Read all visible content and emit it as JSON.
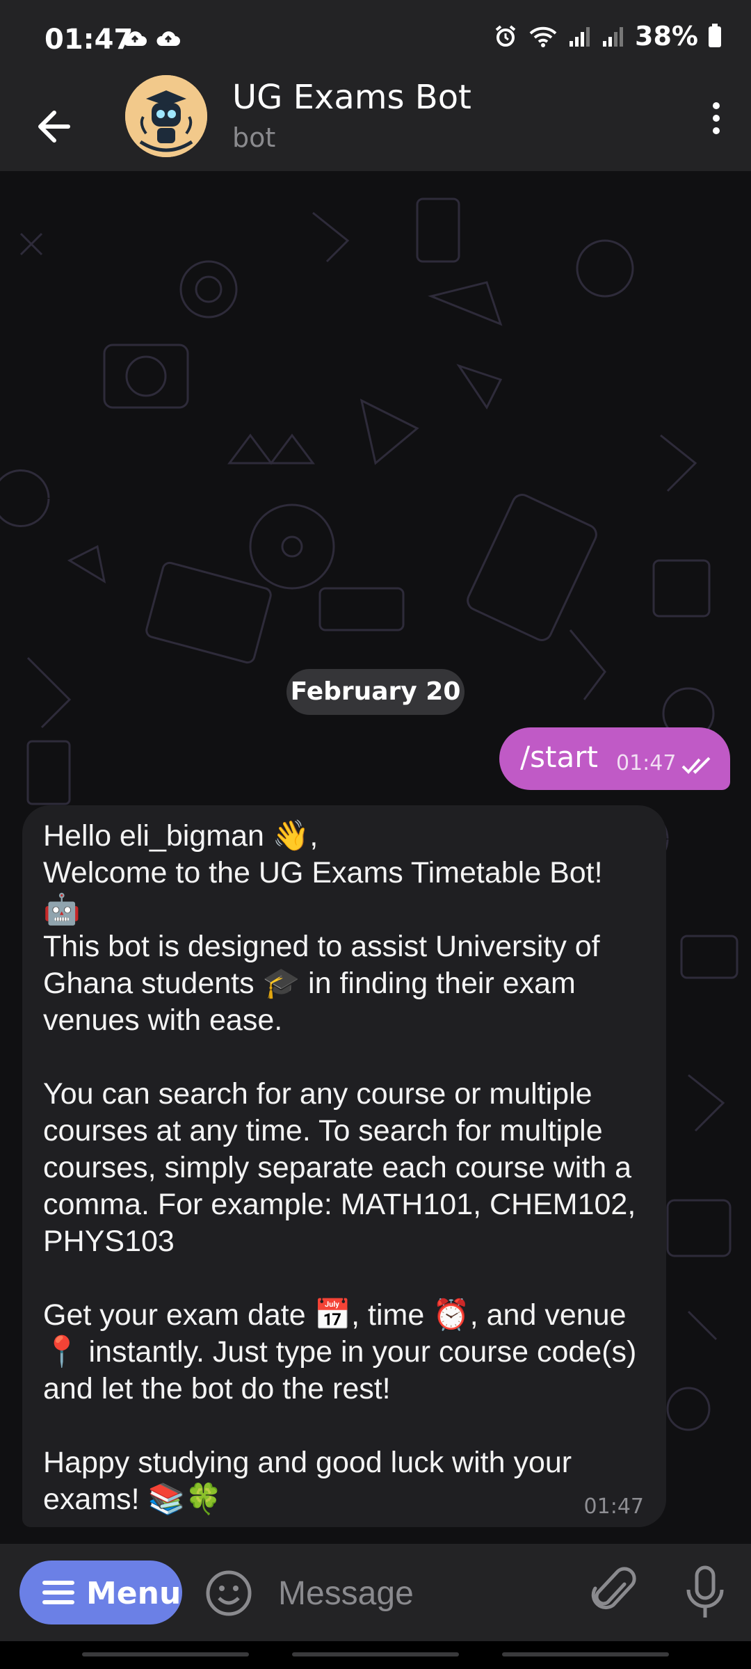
{
  "status_bar": {
    "time": "01:47",
    "battery": "38%"
  },
  "header": {
    "title": "UG Exams Bot",
    "subtitle": "bot"
  },
  "chat": {
    "date_chip": "February 20",
    "outgoing": {
      "text": "/start",
      "time": "01:47"
    },
    "incoming": {
      "text": "Hello eli_bigman 👋,\nWelcome to the UG Exams Timetable Bot!\n🤖\nThis bot is designed to assist University of Ghana students 🎓 in finding their exam venues with ease.\n\nYou can search for any course or multiple courses at any time. To search for multiple courses, simply separate each course with a comma. For example: MATH101, CHEM102, PHYS103\n\nGet your exam date 📅, time ⏰, and venue 📍 instantly. Just type in your course code(s) and let the bot do the rest!\n\nHappy studying and good luck with your exams! 📚🍀",
      "time": "01:47"
    }
  },
  "composer": {
    "menu_label": "Menu",
    "placeholder": "Message"
  },
  "colors": {
    "accent_menu": "#6b80e6",
    "outgoing_bubble": "#c05ac6",
    "incoming_bubble": "#1f1f22",
    "header_bg": "#232325"
  },
  "icons": [
    "cloud-upload-icon",
    "alarm-icon",
    "wifi-icon",
    "signal-icon",
    "battery-icon",
    "back-arrow-icon",
    "more-vert-icon",
    "double-check-icon",
    "menu-lines-icon",
    "emoji-icon",
    "attach-icon",
    "mic-icon"
  ]
}
